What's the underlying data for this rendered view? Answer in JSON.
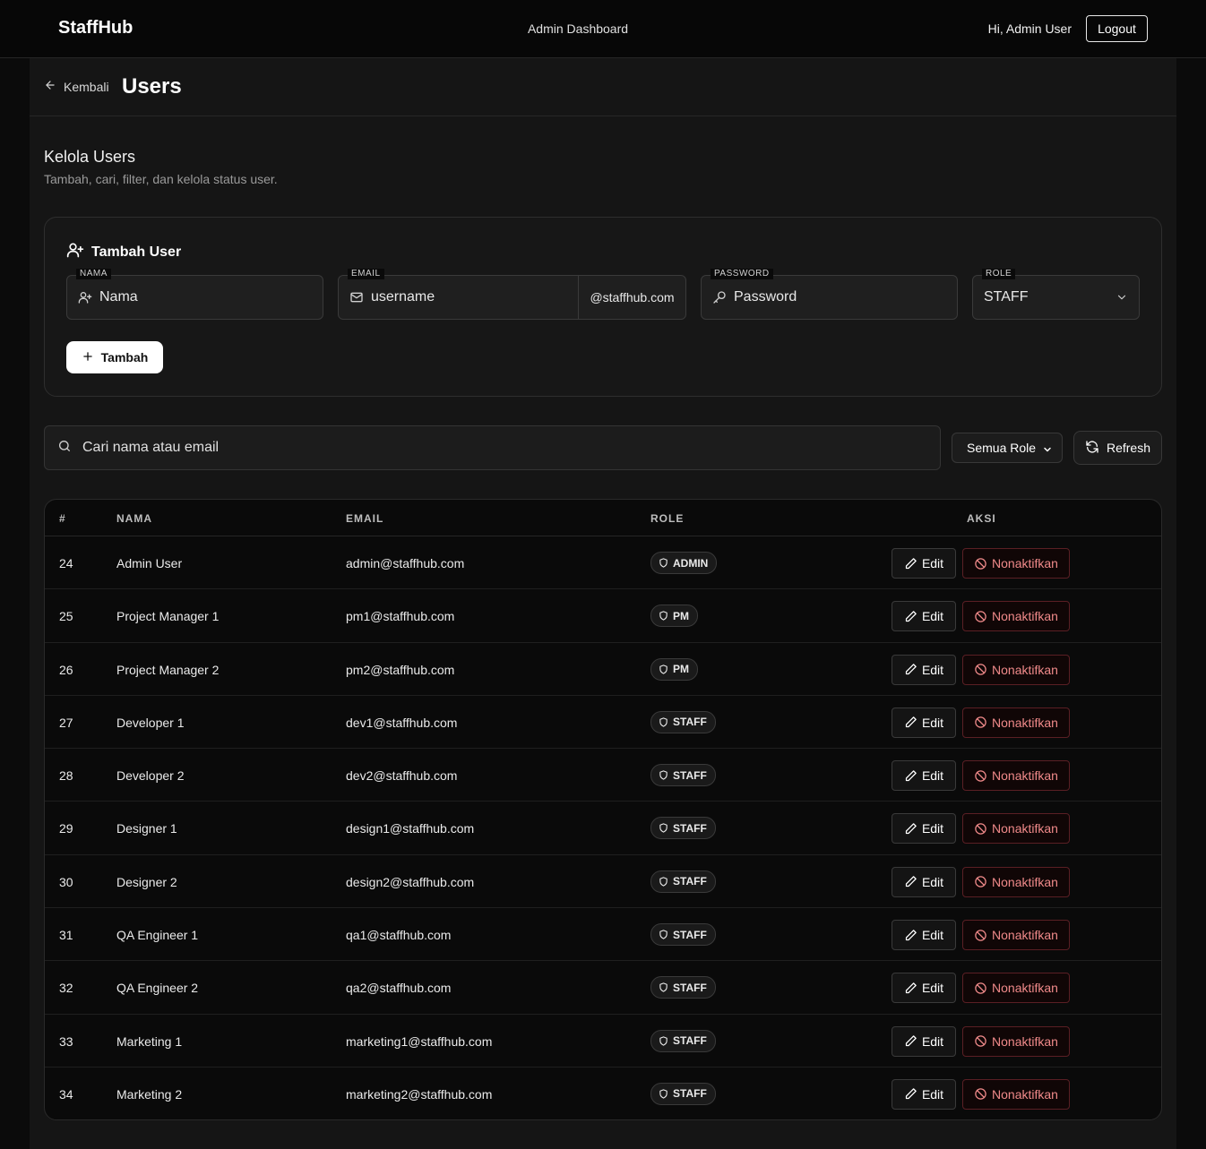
{
  "header": {
    "brand": "StaffHub",
    "title": "Admin Dashboard",
    "greeting": "Hi, Admin User",
    "logout_label": "Logout"
  },
  "page": {
    "back_label": "Kembali",
    "title": "Users",
    "section_title": "Kelola Users",
    "section_subtitle": "Tambah, cari, filter, dan kelola status user."
  },
  "add_form": {
    "title": "Tambah User",
    "name_label": "NAMA",
    "name_placeholder": "Nama",
    "email_label": "EMAIL",
    "email_placeholder": "username",
    "email_suffix": "@staffhub.com",
    "password_label": "PASSWORD",
    "password_placeholder": "Password",
    "role_label": "ROLE",
    "role_value": "STAFF",
    "submit_label": "Tambah"
  },
  "filters": {
    "search_placeholder": "Cari nama atau email",
    "role_filter_value": "Semua Role",
    "refresh_label": "Refresh"
  },
  "table": {
    "columns": [
      "#",
      "NAMA",
      "EMAIL",
      "ROLE",
      "AKSI"
    ],
    "edit_label": "Edit",
    "deactivate_label": "Nonaktifkan",
    "rows": [
      {
        "id": "24",
        "name": "Admin User",
        "email": "admin@staffhub.com",
        "role": "ADMIN"
      },
      {
        "id": "25",
        "name": "Project Manager 1",
        "email": "pm1@staffhub.com",
        "role": "PM"
      },
      {
        "id": "26",
        "name": "Project Manager 2",
        "email": "pm2@staffhub.com",
        "role": "PM"
      },
      {
        "id": "27",
        "name": "Developer 1",
        "email": "dev1@staffhub.com",
        "role": "STAFF"
      },
      {
        "id": "28",
        "name": "Developer 2",
        "email": "dev2@staffhub.com",
        "role": "STAFF"
      },
      {
        "id": "29",
        "name": "Designer 1",
        "email": "design1@staffhub.com",
        "role": "STAFF"
      },
      {
        "id": "30",
        "name": "Designer 2",
        "email": "design2@staffhub.com",
        "role": "STAFF"
      },
      {
        "id": "31",
        "name": "QA Engineer 1",
        "email": "qa1@staffhub.com",
        "role": "STAFF"
      },
      {
        "id": "32",
        "name": "QA Engineer 2",
        "email": "qa2@staffhub.com",
        "role": "STAFF"
      },
      {
        "id": "33",
        "name": "Marketing 1",
        "email": "marketing1@staffhub.com",
        "role": "STAFF"
      },
      {
        "id": "34",
        "name": "Marketing 2",
        "email": "marketing2@staffhub.com",
        "role": "STAFF"
      }
    ]
  },
  "colors": {
    "background": "#0b0b0b",
    "panel": "#151515",
    "danger_text": "#f08a8a",
    "danger_border": "#5a1f24"
  },
  "icons": [
    "arrow-left-icon",
    "user-plus-icon",
    "mail-icon",
    "key-icon",
    "chevron-down-icon",
    "plus-icon",
    "search-icon",
    "refresh-icon",
    "shield-icon",
    "pencil-icon",
    "ban-icon"
  ]
}
